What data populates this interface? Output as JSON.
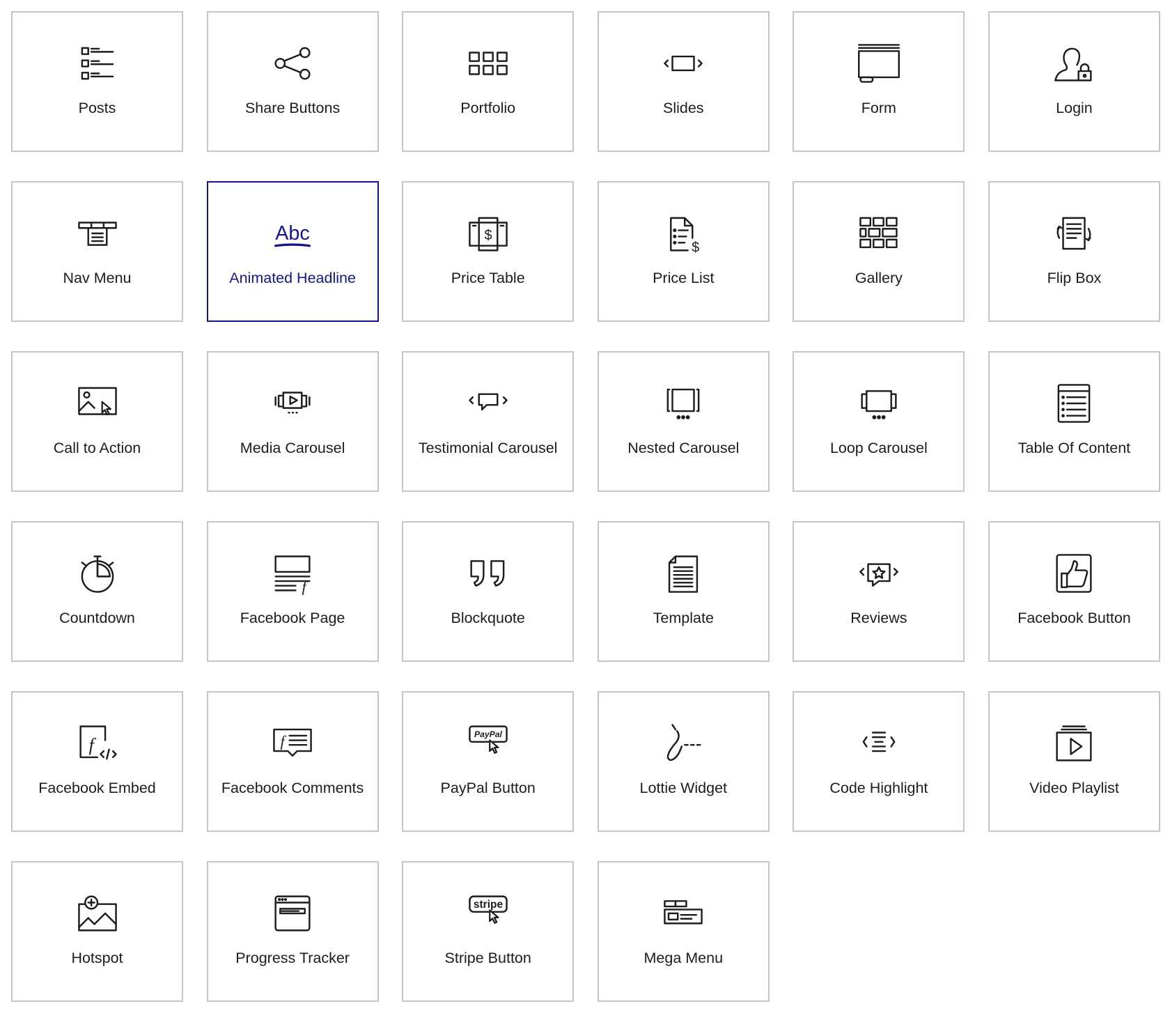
{
  "colors": {
    "border": "#c6c6c6",
    "text": "#1c1c1c",
    "selected": "#16168c"
  },
  "selected_index": 7,
  "widgets": [
    {
      "label": "Posts",
      "icon": "posts-icon"
    },
    {
      "label": "Share Buttons",
      "icon": "share-icon"
    },
    {
      "label": "Portfolio",
      "icon": "portfolio-icon"
    },
    {
      "label": "Slides",
      "icon": "slides-icon"
    },
    {
      "label": "Form",
      "icon": "form-icon"
    },
    {
      "label": "Login",
      "icon": "login-icon"
    },
    {
      "label": "Nav Menu",
      "icon": "nav-menu-icon"
    },
    {
      "label": "Animated Headline",
      "icon": "animated-headline-icon",
      "icon_text": "Abc"
    },
    {
      "label": "Price Table",
      "icon": "price-table-icon"
    },
    {
      "label": "Price List",
      "icon": "price-list-icon"
    },
    {
      "label": "Gallery",
      "icon": "gallery-icon"
    },
    {
      "label": "Flip Box",
      "icon": "flip-box-icon"
    },
    {
      "label": "Call to Action",
      "icon": "call-to-action-icon"
    },
    {
      "label": "Media Carousel",
      "icon": "media-carousel-icon"
    },
    {
      "label": "Testimonial Carousel",
      "icon": "testimonial-carousel-icon"
    },
    {
      "label": "Nested Carousel",
      "icon": "nested-carousel-icon"
    },
    {
      "label": "Loop Carousel",
      "icon": "loop-carousel-icon"
    },
    {
      "label": "Table Of Content",
      "icon": "table-of-content-icon"
    },
    {
      "label": "Countdown",
      "icon": "countdown-icon"
    },
    {
      "label": "Facebook Page",
      "icon": "facebook-page-icon"
    },
    {
      "label": "Blockquote",
      "icon": "blockquote-icon"
    },
    {
      "label": "Template",
      "icon": "template-icon"
    },
    {
      "label": "Reviews",
      "icon": "reviews-icon"
    },
    {
      "label": "Facebook Button",
      "icon": "facebook-button-icon"
    },
    {
      "label": "Facebook Embed",
      "icon": "facebook-embed-icon"
    },
    {
      "label": "Facebook Comments",
      "icon": "facebook-comments-icon"
    },
    {
      "label": "PayPal Button",
      "icon": "paypal-button-icon",
      "icon_text": "PayPal"
    },
    {
      "label": "Lottie Widget",
      "icon": "lottie-icon"
    },
    {
      "label": "Code Highlight",
      "icon": "code-highlight-icon"
    },
    {
      "label": "Video Playlist",
      "icon": "video-playlist-icon"
    },
    {
      "label": "Hotspot",
      "icon": "hotspot-icon"
    },
    {
      "label": "Progress Tracker",
      "icon": "progress-tracker-icon"
    },
    {
      "label": "Stripe Button",
      "icon": "stripe-button-icon",
      "icon_text": "stripe"
    },
    {
      "label": "Mega Menu",
      "icon": "mega-menu-icon"
    }
  ]
}
